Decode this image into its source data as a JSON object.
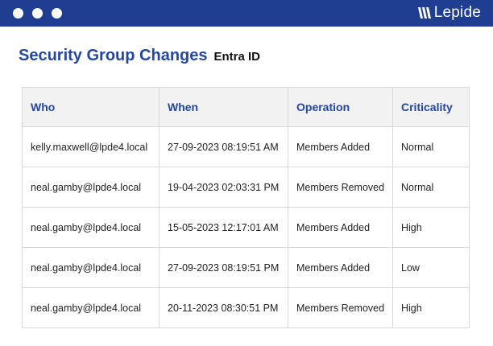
{
  "window": {
    "controls": [
      "close",
      "minimize",
      "maximize"
    ],
    "brand": "Lepide",
    "bar_color": "#1f3e91"
  },
  "report": {
    "title": "Security Group Changes",
    "subtitle": "Entra ID",
    "accent_color": "#2546a3"
  },
  "table": {
    "headers": [
      "Who",
      "When",
      "Operation",
      "Criticality"
    ],
    "rows": [
      {
        "who": "kelly.maxwell@lpde4.local",
        "when": "27-09-2023 08:19:51 AM",
        "operation": "Members Added",
        "criticality": "Normal"
      },
      {
        "who": "neal.gamby@lpde4.local",
        "when": "19-04-2023 02:03:31 PM",
        "operation": "Members Removed",
        "criticality": "Normal"
      },
      {
        "who": "neal.gamby@lpde4.local",
        "when": "15-05-2023 12:17:01 AM",
        "operation": "Members Added",
        "criticality": "High"
      },
      {
        "who": "neal.gamby@lpde4.local",
        "when": "27-09-2023 08:19:51 PM",
        "operation": "Members Added",
        "criticality": "Low"
      },
      {
        "who": "neal.gamby@lpde4.local",
        "when": "20-11-2023 08:30:51 PM",
        "operation": "Members Removed",
        "criticality": "High"
      }
    ]
  }
}
